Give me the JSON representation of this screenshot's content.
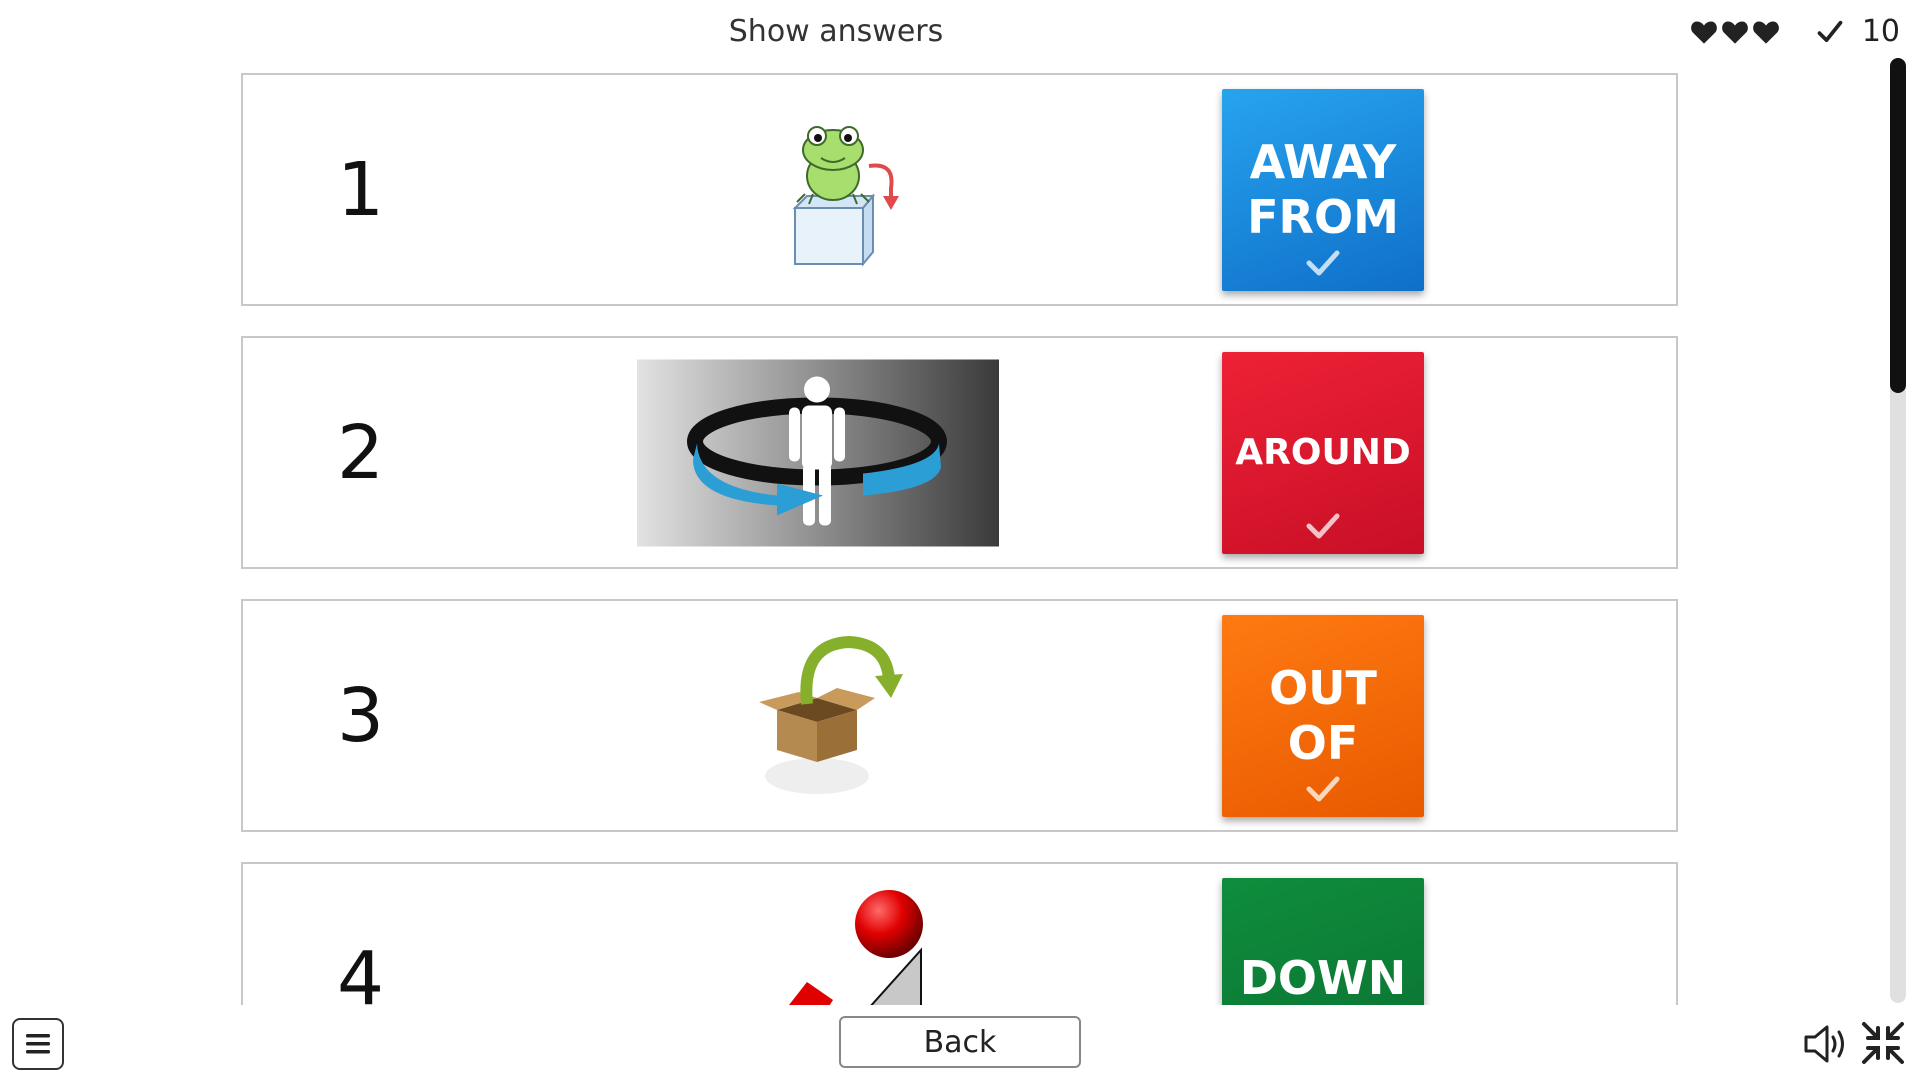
{
  "header": {
    "title": "Show answers",
    "lives": 3,
    "score": "10"
  },
  "rows": [
    {
      "number": "1",
      "image": "frog-jumping-off-ice-cube",
      "answer": "AWAY\nFROM",
      "color": "#1b8ce0"
    },
    {
      "number": "2",
      "image": "person-with-arrow-around",
      "answer": "AROUND",
      "color": "#de1a30"
    },
    {
      "number": "3",
      "image": "arrow-out-of-box",
      "answer": "OUT\nOF",
      "color": "#f46a08"
    },
    {
      "number": "4",
      "image": "ball-rolling-down-slope",
      "answer": "DOWN",
      "color": "#0c7e37"
    }
  ],
  "footer": {
    "back_label": "Back",
    "menu_icon": "hamburger-menu-icon",
    "sound_icon": "speaker-icon",
    "collapse_icon": "exit-fullscreen-icon"
  }
}
